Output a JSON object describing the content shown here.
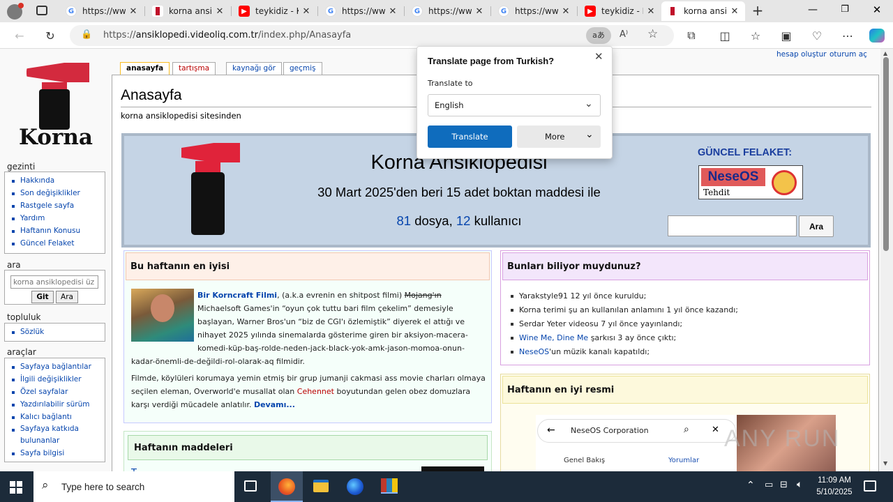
{
  "browser": {
    "tabs": [
      {
        "title": "https://ww",
        "icon": "google-icon"
      },
      {
        "title": "korna ansik",
        "icon": "korna-favicon"
      },
      {
        "title": "teykidiz - K",
        "icon": "youtube-icon"
      },
      {
        "title": "https://ww",
        "icon": "google-icon"
      },
      {
        "title": "https://ww",
        "icon": "google-icon"
      },
      {
        "title": "https://ww",
        "icon": "google-icon"
      },
      {
        "title": "teykidiz - K",
        "icon": "youtube-icon"
      },
      {
        "title": "korna ansik",
        "icon": "korna-favicon",
        "active": true
      }
    ],
    "url_prefix": "https://",
    "url_host": "ansiklopedi.videoliq.com.tr",
    "url_path": "/index.php/Anasayfa",
    "translate_badge": "aあ"
  },
  "wiki": {
    "logo_text": "Korna",
    "user_links": {
      "create": "hesap oluştur",
      "login": "oturum aç"
    },
    "tabs": {
      "page": "anasayfa",
      "talk": "tartışma",
      "source": "kaynağı gör",
      "history": "geçmiş"
    },
    "nav_heading": "gezinti",
    "nav": [
      "Hakkında",
      "Son değişiklikler",
      "Rastgele sayfa",
      "Yardım",
      "Haftanın Konusu",
      "Güncel Felaket"
    ],
    "search_heading": "ara",
    "search_placeholder": "korna ansiklopedisi üz",
    "search_go": "Git",
    "search_btn": "Ara",
    "community_heading": "topluluk",
    "community": [
      "Sözlük"
    ],
    "tools_heading": "araçlar",
    "tools": [
      "Sayfaya bağlantılar",
      "İlgili değişiklikler",
      "Özel sayfalar",
      "Yazdırılabilir sürüm",
      "Kalıcı bağlantı",
      "Sayfaya katkıda bulunanlar",
      "Sayfa bilgisi"
    ],
    "page_title": "Anasayfa",
    "subtitle": "korna ansiklopedisi sitesinden",
    "banner": {
      "title": "Korna Ansiklopedisi",
      "line2": "30 Mart 2025'den beri 15 adet boktan maddesi ile",
      "files_count": "81",
      "files_label": "dosya,",
      "users_count": "12",
      "users_label": "kullanıcı",
      "disaster_title": "GÜNCEL FELAKET:",
      "disaster_img_title": "NeseOS",
      "disaster_img_sub": "Tehdit",
      "search_btn": "Ara"
    },
    "best": {
      "heading": "Bu haftanın en iyisi",
      "film_link": "Bir Korncraft Filmi",
      "p1a": ", (a.k.a evrenin en shitpost filmi) ",
      "strike": "Mojang'ın",
      "p1b": " Michaelsoft Games'in “oyun çok tuttu bari film çekelim” demesiyle başlayan, Warner Bros'un “biz de CGI'ı özlemiştik” diyerek el attığı ve nihayet 2025 yılında sinemalarda gösterime giren bir aksiyon-macera-komedi-küp-baş-rolde-neden-jack-black-yok-amk-jason-momoa-onun-kadar-önemli-de-değildi-rol-olarak-aq filmidir.",
      "p2a": "Filmde, köylüleri korumaya yemin etmiş bir grup jumanji cakmasi ass movie charları olmaya seçilen eleman, Overworld'e musallat olan ",
      "p2link": "Cehennet",
      "p2b": " boyutundan gelen obez domuzlara karşı verdiği mücadele anlatılır. ",
      "more": "Devamı..."
    },
    "know": {
      "heading": "Bunları biliyor muydunuz?",
      "items": [
        {
          "pre": "",
          "link": "",
          "text": "Yarakstyle91 12 yıl önce kuruldu;"
        },
        {
          "pre": "",
          "link": "",
          "text": "Korna terimi şu an kullanılan anlamını 1 yıl önce kazandı;"
        },
        {
          "pre": "",
          "link": "",
          "text": "Serdar Yeter videosu 7 yıl önce yayınlandı;"
        },
        {
          "pre": "",
          "link": "Wine Me, Dine Me",
          "text": " şarkısı 3 ay önce çıktı;"
        },
        {
          "pre": "",
          "link": "NeseOS",
          "text": "'un müzik kanalı kapatıldı;"
        }
      ]
    },
    "articles": {
      "heading": "Haftanın maddeleri",
      "first": "T"
    },
    "picture": {
      "heading": "Haftanın en iyi resmi",
      "app_title": "NeseOS Corporation",
      "tab1": "Genel Bakış",
      "tab2": "Yorumlar"
    }
  },
  "translate": {
    "title": "Translate page from Turkish?",
    "label": "Translate to",
    "language": "English",
    "translate_btn": "Translate",
    "more_btn": "More"
  },
  "taskbar": {
    "search_placeholder": "Type here to search",
    "time": "11:09 AM",
    "date": "5/10/2025"
  },
  "watermark": "ANY RUN"
}
